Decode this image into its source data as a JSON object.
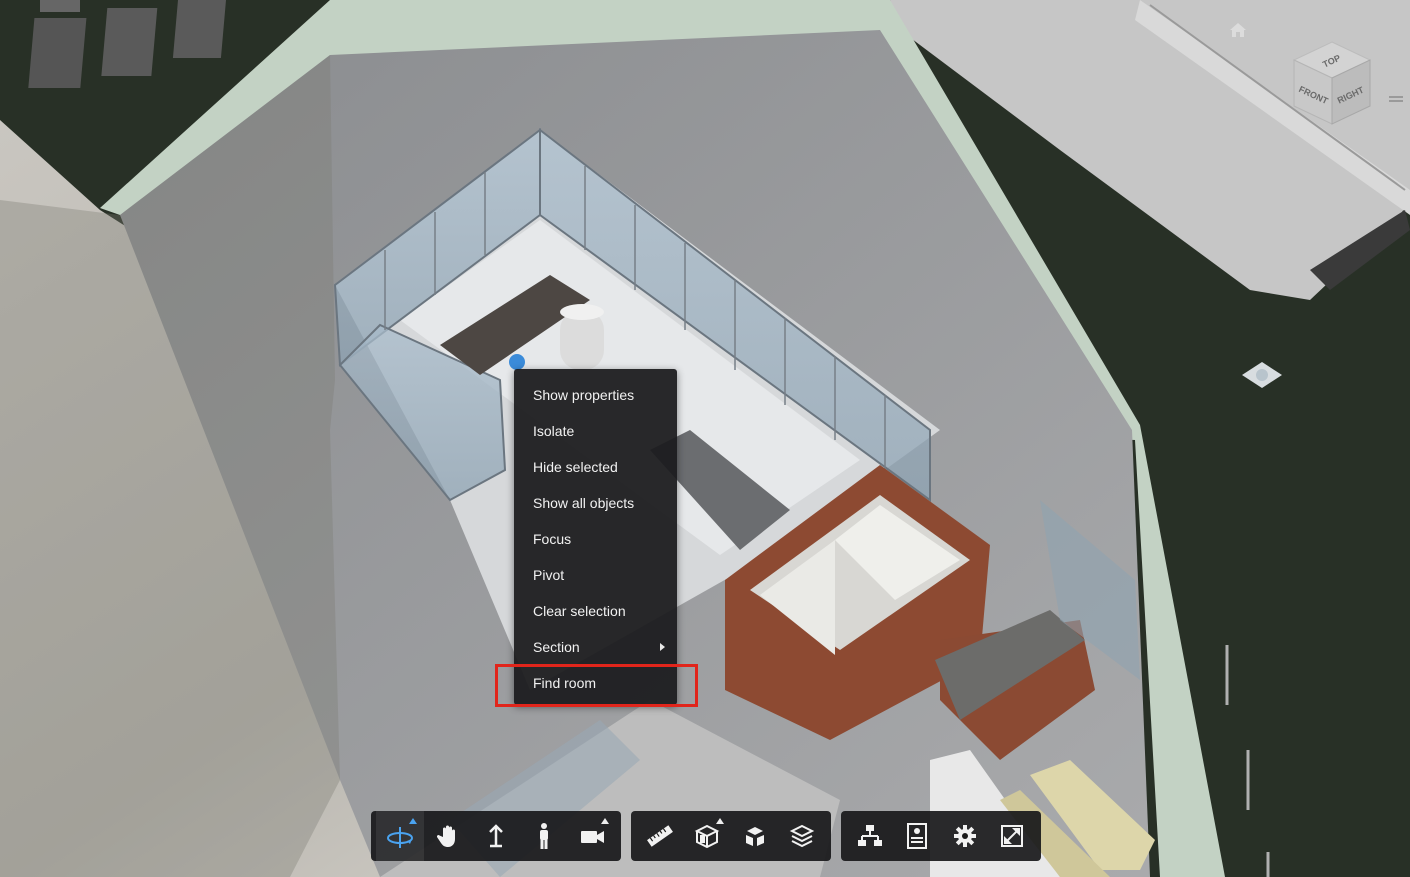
{
  "context_menu": {
    "items": [
      {
        "label": "Show properties",
        "has_submenu": false
      },
      {
        "label": "Isolate",
        "has_submenu": false
      },
      {
        "label": "Hide selected",
        "has_submenu": false
      },
      {
        "label": "Show all objects",
        "has_submenu": false
      },
      {
        "label": "Focus",
        "has_submenu": false
      },
      {
        "label": "Pivot",
        "has_submenu": false
      },
      {
        "label": "Clear selection",
        "has_submenu": false
      },
      {
        "label": "Section",
        "has_submenu": true
      },
      {
        "label": "Find room",
        "has_submenu": false
      }
    ],
    "highlighted_item": "Find room",
    "highlight_color": "#e1251b"
  },
  "viewcube": {
    "faces": {
      "top": "TOP",
      "front": "FRONT",
      "right": "RIGHT"
    }
  },
  "toolbar": {
    "navigation": [
      {
        "icon": "orbit-icon",
        "active": true,
        "has_more": true
      },
      {
        "icon": "pan-icon",
        "active": false,
        "has_more": false
      },
      {
        "icon": "zoom-icon",
        "active": false,
        "has_more": false
      },
      {
        "icon": "first-person-icon",
        "active": false,
        "has_more": false
      },
      {
        "icon": "camera-icon",
        "active": false,
        "has_more": true
      }
    ],
    "modeling": [
      {
        "icon": "measure-icon",
        "has_more": false
      },
      {
        "icon": "section-icon",
        "has_more": true
      },
      {
        "icon": "explode-icon",
        "has_more": false
      },
      {
        "icon": "layers-icon",
        "has_more": false
      }
    ],
    "settings": [
      {
        "icon": "model-browser-icon",
        "has_more": false
      },
      {
        "icon": "properties-icon",
        "has_more": false
      },
      {
        "icon": "settings-gear-icon",
        "has_more": false
      },
      {
        "icon": "fullscreen-icon",
        "has_more": false
      }
    ],
    "accent_color": "#4aa3f0"
  }
}
